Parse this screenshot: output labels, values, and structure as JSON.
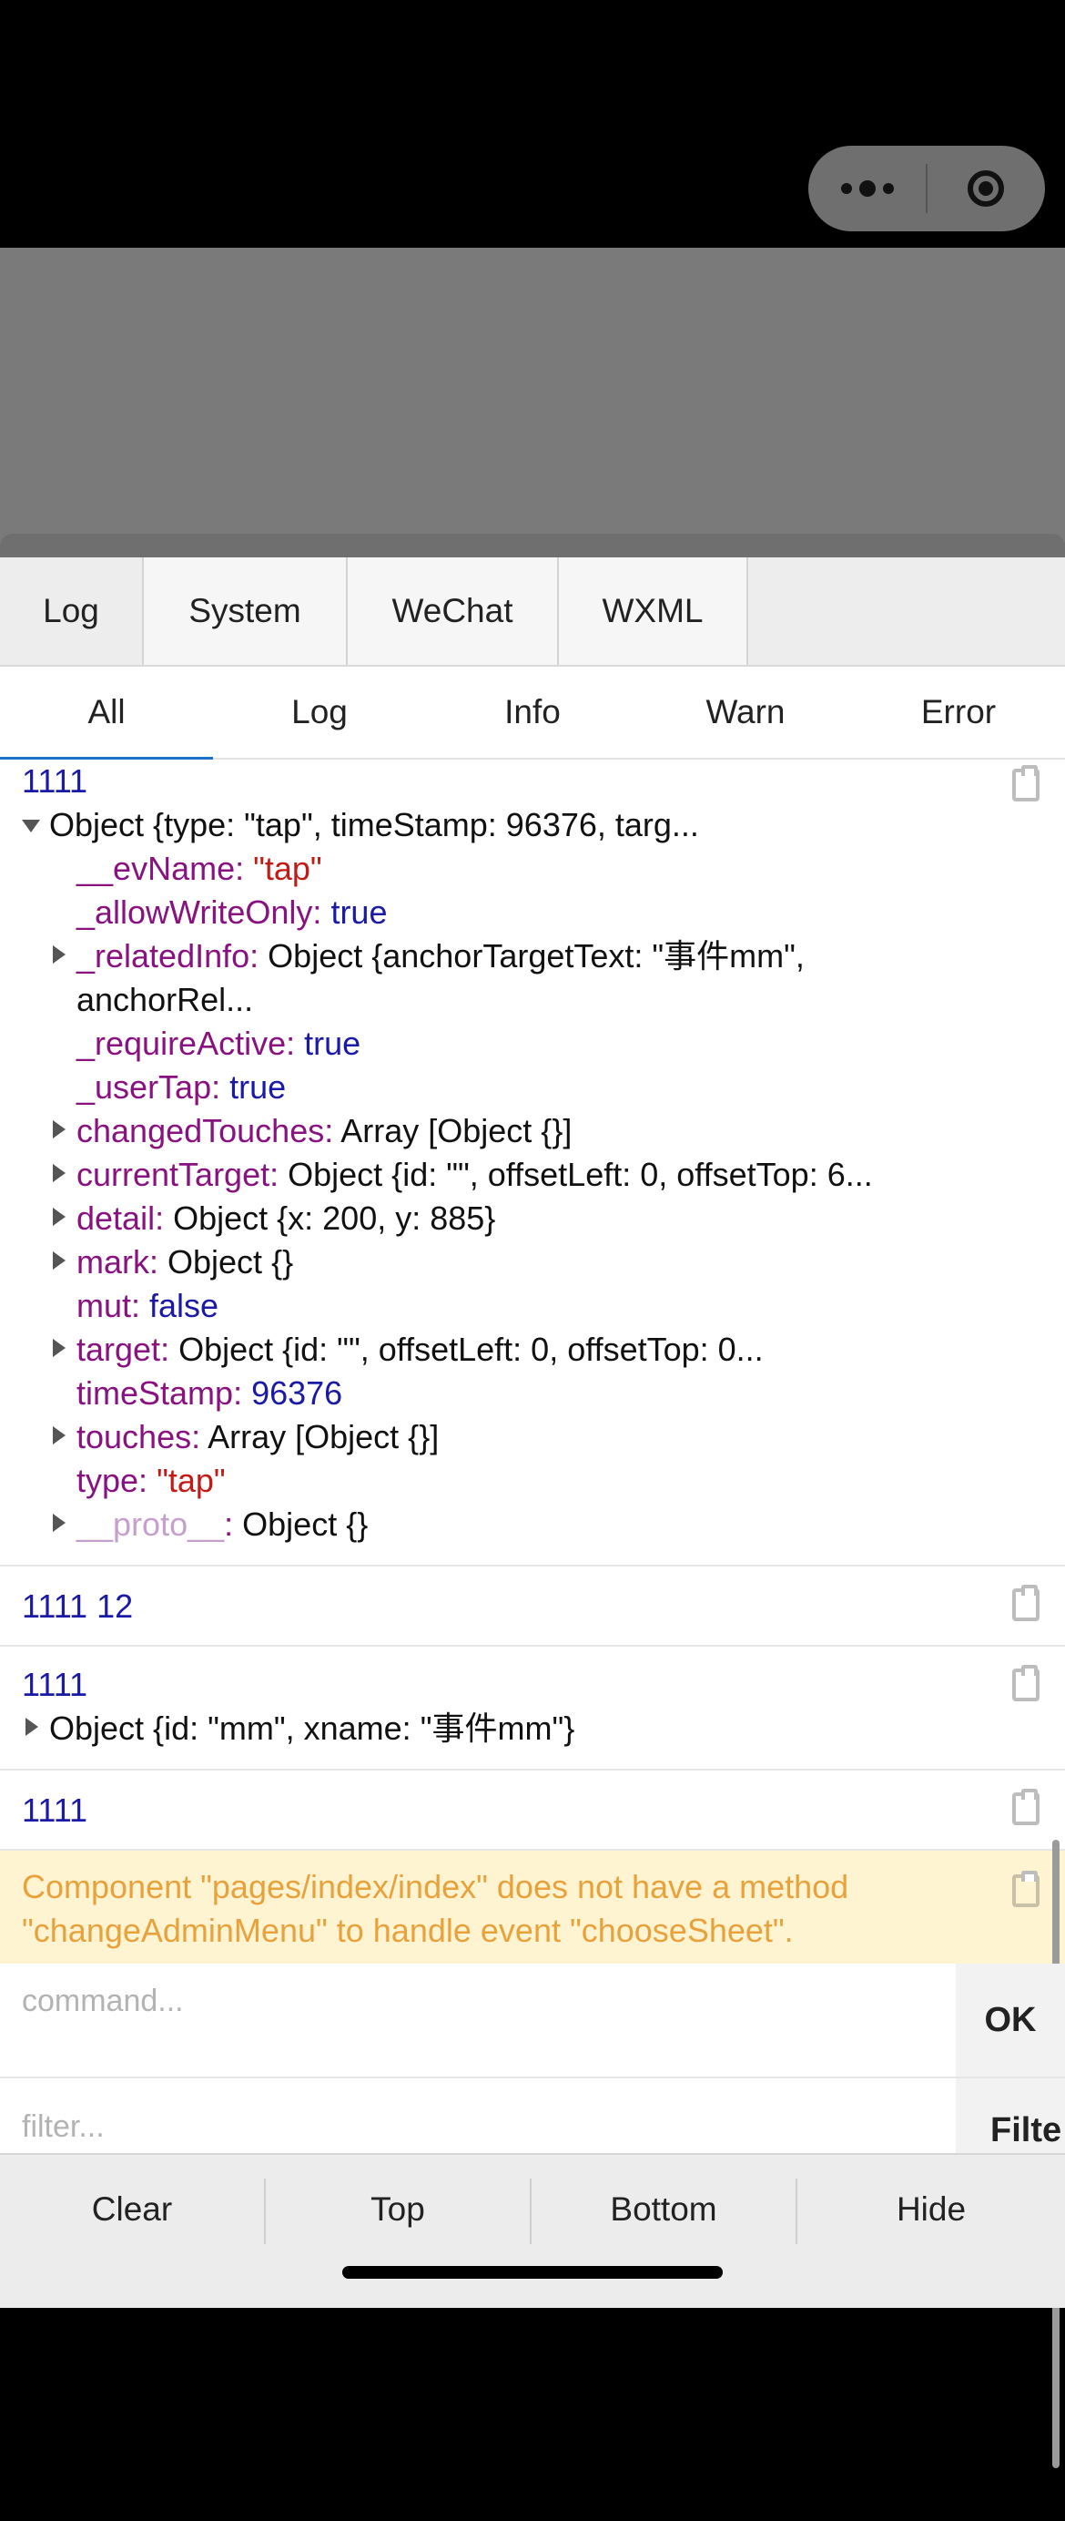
{
  "top_tabs": [
    "Log",
    "System",
    "WeChat",
    "WXML"
  ],
  "level_tabs": [
    "All",
    "Log",
    "Info",
    "Warn",
    "Error"
  ],
  "entries": {
    "first_label": "1111",
    "object_summary": "Object {type: \"tap\", timeStamp: 96376, targ...",
    "props": {
      "evName_key": "__evName",
      "evName_val": "\"tap\"",
      "allowWriteOnly_key": "_allowWriteOnly",
      "allowWriteOnly_val": "true",
      "relatedInfo_key": "_relatedInfo",
      "relatedInfo_val": "Object {anchorTargetText: \"事件mm\",",
      "relatedInfo_cont": "anchorRel...",
      "requireActive_key": "_requireActive",
      "requireActive_val": "true",
      "userTap_key": "_userTap",
      "userTap_val": "true",
      "changedTouches_key": "changedTouches",
      "changedTouches_val": "Array [Object {}]",
      "currentTarget_key": "currentTarget",
      "currentTarget_val": "Object {id: \"\", offsetLeft: 0, offsetTop: 6...",
      "detail_key": "detail",
      "detail_val": "Object {x: 200, y: 885}",
      "mark_key": "mark",
      "mark_val": "Object {}",
      "mut_key": "mut",
      "mut_val": "false",
      "target_key": "target",
      "target_val": "Object {id: \"\", offsetLeft: 0, offsetTop: 0...",
      "timeStamp_key": "timeStamp",
      "timeStamp_val": "96376",
      "touches_key": "touches",
      "touches_val": "Array [Object {}]",
      "type_key": "type",
      "type_val": "\"tap\"",
      "proto_key": "__proto__",
      "proto_val": "Object {}"
    },
    "second_label": "1111 12",
    "third_label": "1111",
    "third_object": "Object {id: \"mm\", xname: \"事件mm\"}",
    "fourth_label": "1111",
    "warning_line1": "Component \"pages/index/index\" does not have a method",
    "warning_line2": "\"changeAdminMenu\" to handle event \"chooseSheet\"."
  },
  "command": {
    "placeholder": "command...",
    "ok_label": "OK"
  },
  "filter": {
    "placeholder": "filter...",
    "button_label": "Filte"
  },
  "bottom_bar": {
    "clear": "Clear",
    "top": "Top",
    "bottom": "Bottom",
    "hide": "Hide"
  },
  "colors": {
    "accent": "#1a73c8",
    "warning_bg": "#fff4d2",
    "warning_text": "#e9a23b",
    "key": "#881280",
    "string": "#c41a16",
    "number": "#1a1aa6"
  }
}
